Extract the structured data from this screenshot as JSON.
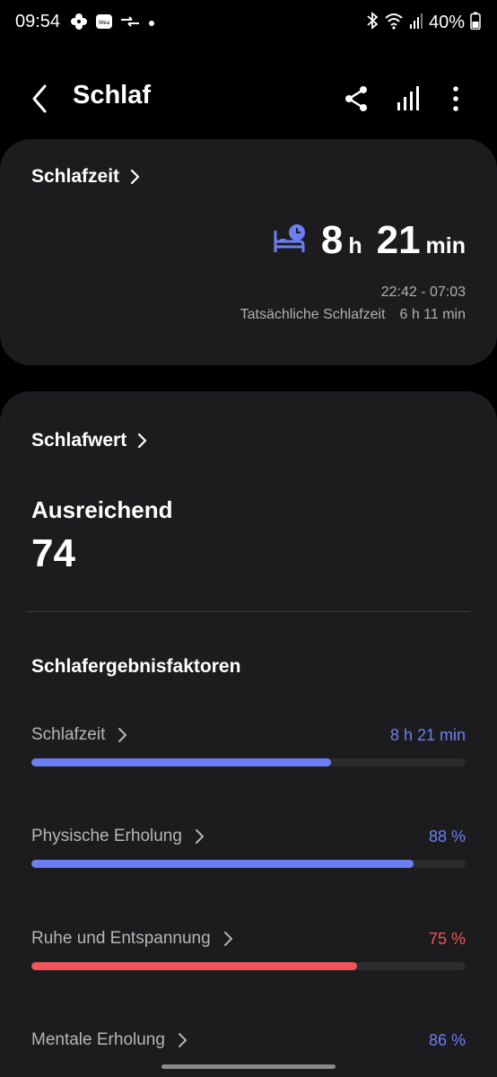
{
  "statusbar": {
    "time": "09:54",
    "battery": "40%",
    "icons": [
      "pinwheel-icon",
      "weather-app-icon",
      "data-transfer-icon",
      "dot-icon",
      "bluetooth-icon",
      "wifi-icon",
      "signal-icon",
      "battery-icon"
    ]
  },
  "header": {
    "title": "Schlaf",
    "icons": [
      "back-icon",
      "share-icon",
      "stats-icon",
      "more-icon"
    ]
  },
  "sleep_time_card": {
    "label": "Schlafzeit",
    "hours": "8",
    "hours_unit": "h",
    "minutes": "21",
    "minutes_unit": "min",
    "range": "22:42 - 07:03",
    "actual_label": "Tatsächliche Schlafzeit",
    "actual_value": "6 h 11 min"
  },
  "score_card": {
    "label": "Schlafwert",
    "rating": "Ausreichend",
    "score": "74",
    "factors_title": "Schlafergebnisfaktoren",
    "factors": [
      {
        "name": "Schlafzeit",
        "value": "8 h 21 min",
        "fill": 0.69,
        "color": "#6b7ff2"
      },
      {
        "name": "Physische Erholung",
        "value": "88 %",
        "fill": 0.88,
        "color": "#6b7ff2"
      },
      {
        "name": "Ruhe und Entspannung",
        "value": "75 %",
        "fill": 0.75,
        "color": "#f0545a"
      },
      {
        "name": "Mentale Erholung",
        "value": "86 %",
        "fill": 0.86,
        "color": "#6b7ff2"
      }
    ]
  },
  "colors": {
    "accent": "#6b7ff2",
    "warning": "#f0545a",
    "card_bg": "#1c1c1e"
  }
}
